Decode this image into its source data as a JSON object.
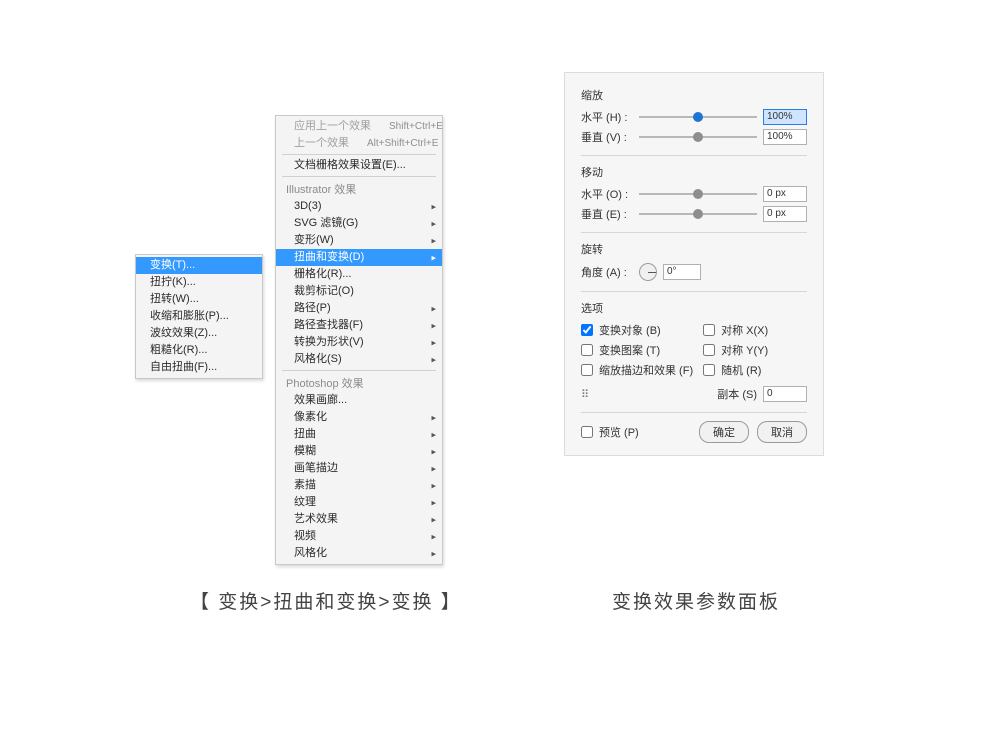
{
  "submenu1": {
    "items": [
      {
        "label": "变换(T)...",
        "selected": true
      },
      {
        "label": "扭拧(K)..."
      },
      {
        "label": "扭转(W)..."
      },
      {
        "label": "收缩和膨胀(P)..."
      },
      {
        "label": "波纹效果(Z)..."
      },
      {
        "label": "粗糙化(R)..."
      },
      {
        "label": "自由扭曲(F)..."
      }
    ]
  },
  "mainmenu": {
    "top": [
      {
        "label": "应用上一个效果",
        "shortcut": "Shift+Ctrl+E",
        "disabled": true
      },
      {
        "label": "上一个效果",
        "shortcut": "Alt+Shift+Ctrl+E",
        "disabled": true
      }
    ],
    "doc_grid": "文档栅格效果设置(E)...",
    "ill_header": "Illustrator 效果",
    "ill_items": [
      {
        "label": "3D(3)",
        "arrow": true
      },
      {
        "label": "SVG 滤镜(G)",
        "arrow": true
      },
      {
        "label": "变形(W)",
        "arrow": true
      },
      {
        "label": "扭曲和变换(D)",
        "arrow": true,
        "selected": true
      },
      {
        "label": "栅格化(R)...",
        "arrow": false
      },
      {
        "label": "裁剪标记(O)",
        "arrow": false
      },
      {
        "label": "路径(P)",
        "arrow": true
      },
      {
        "label": "路径查找器(F)",
        "arrow": true
      },
      {
        "label": "转换为形状(V)",
        "arrow": true
      },
      {
        "label": "风格化(S)",
        "arrow": true
      }
    ],
    "ps_header": "Photoshop 效果",
    "ps_items": [
      {
        "label": "效果画廊...",
        "arrow": false
      },
      {
        "label": "像素化",
        "arrow": true
      },
      {
        "label": "扭曲",
        "arrow": true
      },
      {
        "label": "模糊",
        "arrow": true
      },
      {
        "label": "画笔描边",
        "arrow": true
      },
      {
        "label": "素描",
        "arrow": true
      },
      {
        "label": "纹理",
        "arrow": true
      },
      {
        "label": "艺术效果",
        "arrow": true
      },
      {
        "label": "视频",
        "arrow": true
      },
      {
        "label": "风格化",
        "arrow": true
      }
    ]
  },
  "dialog": {
    "scale": {
      "header": "缩放",
      "h_label": "水平 (H) :",
      "h_value": "100%",
      "v_label": "垂直 (V) :",
      "v_value": "100%",
      "pos": 50
    },
    "move": {
      "header": "移动",
      "h_label": "水平 (O) :",
      "h_value": "0 px",
      "v_label": "垂直 (E) :",
      "v_value": "0 px",
      "pos": 50
    },
    "rotate": {
      "header": "旋转",
      "label": "角度 (A) :",
      "value": "0°"
    },
    "options": {
      "header": "选项",
      "cb1": "变换对象 (B)",
      "cb2": "对称 X(X)",
      "cb3": "变换图案 (T)",
      "cb4": "对称 Y(Y)",
      "cb5": "缩放描边和效果 (F)",
      "cb6": "随机 (R)"
    },
    "copies": {
      "grip": "⠿",
      "label": "副本 (S)",
      "value": "0"
    },
    "preview": "预览 (P)",
    "ok": "确定",
    "cancel": "取消"
  },
  "captions": {
    "left": "【 变换>扭曲和变换>变换 】",
    "right": "变换效果参数面板"
  }
}
